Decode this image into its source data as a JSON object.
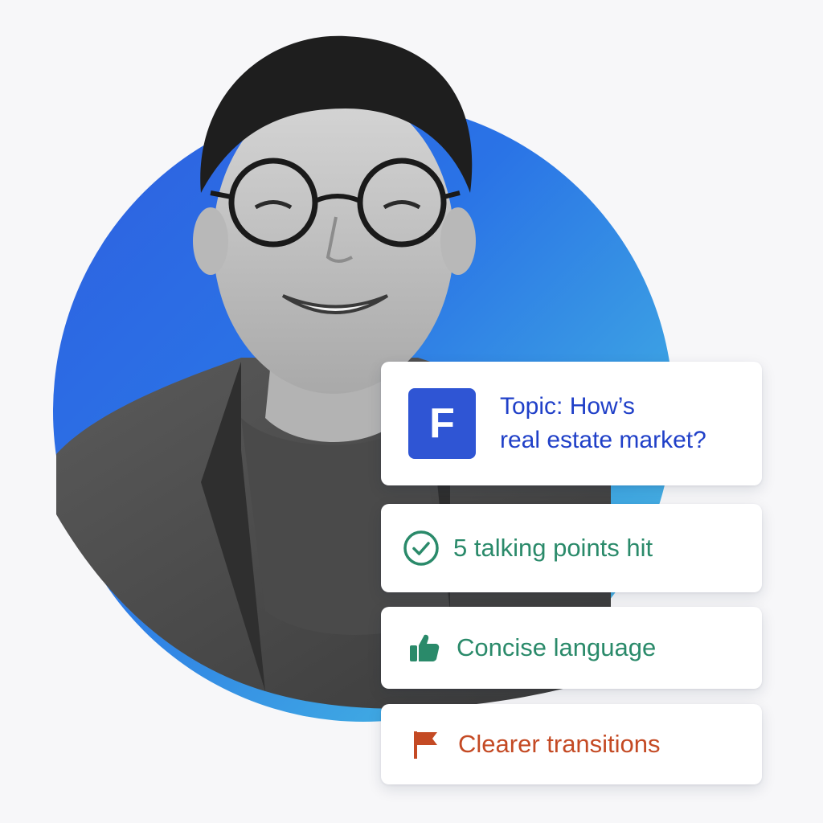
{
  "cards": {
    "topic": {
      "logo_letter": "F",
      "line1": "Topic: How’s",
      "line2": "real estate market?"
    },
    "points": {
      "label": "5 talking points hit",
      "icon": "check-circle-icon"
    },
    "concise": {
      "label": "Concise language",
      "icon": "thumbs-up-icon"
    },
    "transitions": {
      "label": "Clearer transitions",
      "icon": "flag-icon"
    }
  },
  "colors": {
    "brand_blue": "#2f55d4",
    "topic_text": "#2040c8",
    "positive_green": "#2a8a6a",
    "improve_orange": "#c44a24",
    "circle_start": "#2f5fe0",
    "circle_end": "#56c0e6"
  }
}
